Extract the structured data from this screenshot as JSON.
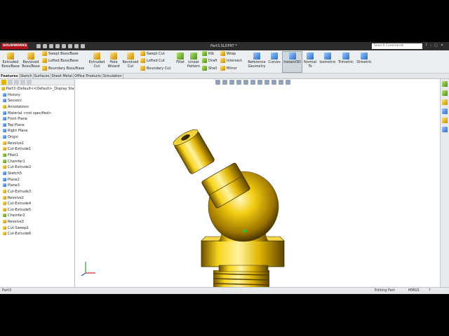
{
  "window": {
    "app_logo": "SOLIDWORKS",
    "title": "Part3.SLDPRT *",
    "search_placeholder": "Search Commands",
    "controls": [
      "?",
      "–",
      "□",
      "✕"
    ]
  },
  "ribbon": {
    "extruded_boss": "Extruded Boss/Base",
    "revolved_boss": "Revolved Boss/Base",
    "swept_boss": "Swept Boss/Base",
    "lofted_boss": "Lofted Boss/Base",
    "boundary_boss": "Boundary Boss/Base",
    "extruded_cut": "Extruded Cut",
    "hole_wizard": "Hole Wizard",
    "revolved_cut": "Revolved Cut",
    "swept_cut": "Swept Cut",
    "lofted_cut": "Lofted Cut",
    "boundary_cut": "Boundary Cut",
    "fillet": "Fillet",
    "linear_pattern": "Linear Pattern",
    "rib": "Rib",
    "draft": "Draft",
    "shell": "Shell",
    "wrap": "Wrap",
    "intersect": "Intersect",
    "mirror": "Mirror",
    "reference_geometry": "Reference Geometry",
    "curves": "Curves",
    "instant3d": "Instant3D",
    "normal_to": "Normal To",
    "isometric": "Isometric",
    "trimetric": "Trimetric",
    "dimetric": "Dimetric"
  },
  "tabs": [
    "Features",
    "Sketch",
    "Surfaces",
    "Sheet Metal",
    "Office Products",
    "Simulation"
  ],
  "tree": {
    "root": "Part3 (Default<<Default>_Display Sta",
    "items": [
      "History",
      "Sensors",
      "Annotations",
      "Material <not specified>",
      "Front Plane",
      "Top Plane",
      "Right Plane",
      "Origin",
      "Revolve1",
      "Cut-Extrude1",
      "Fillet1",
      "Chamfer1",
      "Cut-Extrude2",
      "Sketch5",
      "Plane2",
      "Plane3",
      "Cut-Extrude3",
      "Revolve2",
      "Cut-Extrude4",
      "Cut-Extrude5",
      "Chamfer2",
      "Revolve3",
      "Cut-Sweep1",
      "Cut-Extrude6"
    ]
  },
  "status": {
    "left": "Part3",
    "mode": "Editing Part",
    "units": "MMGS"
  },
  "colors": {
    "part": "#e8c000",
    "ribbon_bg": "#eceff1",
    "logo": "#b5121b"
  }
}
